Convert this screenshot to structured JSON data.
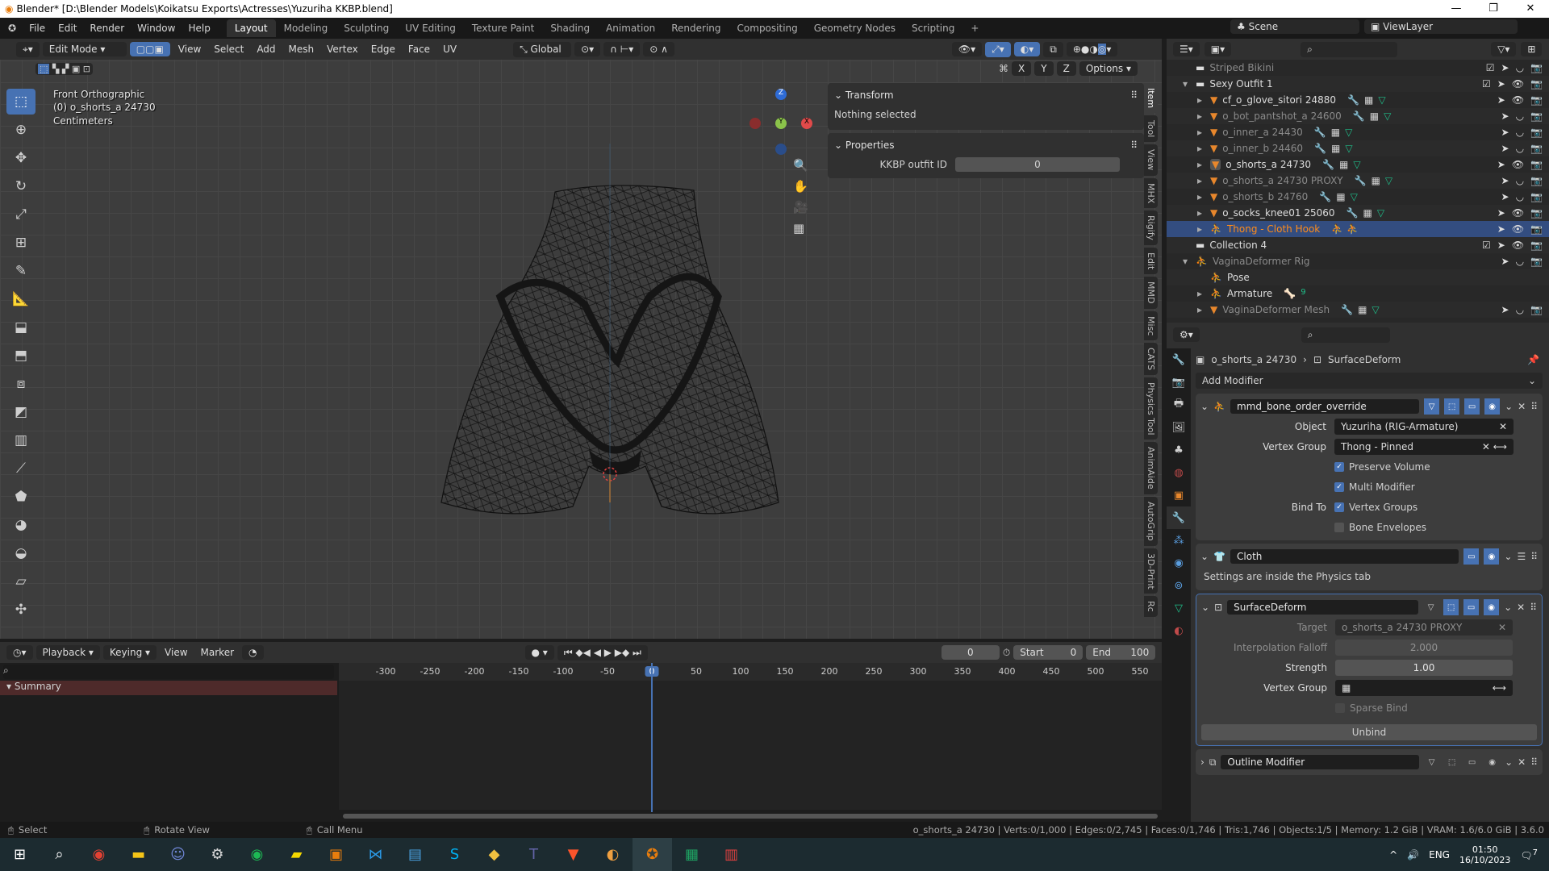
{
  "window": {
    "title": "Blender* [D:\\Blender Models\\Koikatsu Exports\\Actresses\\Yuzuriha KKBP.blend]"
  },
  "menu": [
    "File",
    "Edit",
    "Render",
    "Window",
    "Help"
  ],
  "workspaces": [
    "Layout",
    "Modeling",
    "Sculpting",
    "UV Editing",
    "Texture Paint",
    "Shading",
    "Animation",
    "Rendering",
    "Compositing",
    "Geometry Nodes",
    "Scripting",
    "+"
  ],
  "scene": {
    "name": "Scene",
    "view_layer": "ViewLayer"
  },
  "viewport": {
    "mode": "Edit Mode",
    "header_menus": [
      "View",
      "Select",
      "Add",
      "Mesh",
      "Vertex",
      "Edge",
      "Face",
      "UV"
    ],
    "orientation": "Global",
    "axes": [
      "X",
      "Y",
      "Z"
    ],
    "options": "Options",
    "overlay_lines": [
      "Front Orthographic",
      "(0) o_shorts_a 24730",
      "Centimeters"
    ],
    "gizmo": {
      "z": "Z",
      "y": "Y",
      "x": "X"
    },
    "npanel": {
      "transform_title": "Transform",
      "nothing_selected": "Nothing selected",
      "properties_title": "Properties",
      "kkbp_label": "KKBP outfit ID",
      "kkbp_value": "0"
    },
    "side_tabs": [
      "Item",
      "Tool",
      "View",
      "MHX",
      "Rigify",
      "Edit",
      "MMD",
      "Misc",
      "CATS",
      "Physics Tool",
      "AnimAide",
      "AutoGrip",
      "3D-Print",
      "Rc"
    ]
  },
  "outliner": {
    "rows": [
      {
        "name": "Striped Bikini",
        "type": "collection",
        "dim": true
      },
      {
        "name": "Sexy Outfit 1",
        "type": "collection"
      },
      {
        "name": "cf_o_glove_sitori 24880",
        "type": "mesh"
      },
      {
        "name": "o_bot_pantshot_a 24600",
        "type": "mesh",
        "dim": true
      },
      {
        "name": "o_inner_a 24430",
        "type": "mesh",
        "dim": true
      },
      {
        "name": "o_inner_b 24460",
        "type": "mesh",
        "dim": true
      },
      {
        "name": "o_shorts_a 24730",
        "type": "mesh",
        "active": true
      },
      {
        "name": "o_shorts_a 24730 PROXY",
        "type": "mesh",
        "dim": true
      },
      {
        "name": "o_shorts_b 24760",
        "type": "mesh",
        "dim": true
      },
      {
        "name": "o_socks_knee01 25060",
        "type": "mesh"
      },
      {
        "name": "Thong - Cloth Hook",
        "type": "armature",
        "selected": true
      },
      {
        "name": "Collection 4",
        "type": "collection"
      },
      {
        "name": "VaginaDeformer Rig",
        "type": "armature",
        "dim": true
      },
      {
        "name": "Pose",
        "type": "pose"
      },
      {
        "name": "Armature",
        "type": "armature-data",
        "badge": "9"
      },
      {
        "name": "VaginaDeformer Mesh",
        "type": "mesh",
        "dim": true
      }
    ]
  },
  "properties": {
    "breadcrumb_object": "o_shorts_a 24730",
    "breadcrumb_modifier": "SurfaceDeform",
    "add_modifier": "Add Modifier",
    "mod1": {
      "name": "mmd_bone_order_override",
      "object_label": "Object",
      "object_value": "Yuzuriha (RIG-Armature)",
      "vg_label": "Vertex Group",
      "vg_value": "Thong - Pinned",
      "preserve_volume": "Preserve Volume",
      "multi_modifier": "Multi Modifier",
      "bind_to": "Bind To",
      "vertex_groups": "Vertex Groups",
      "bone_envelopes": "Bone Envelopes"
    },
    "mod2": {
      "name": "Cloth",
      "note": "Settings are inside the Physics tab"
    },
    "mod3": {
      "name": "SurfaceDeform",
      "target_label": "Target",
      "target_value": "o_shorts_a 24730 PROXY",
      "falloff_label": "Interpolation Falloff",
      "falloff_value": "2.000",
      "strength_label": "Strength",
      "strength_value": "1.00",
      "vg_label": "Vertex Group",
      "sparse_bind": "Sparse Bind",
      "unbind": "Unbind"
    },
    "mod4": {
      "name": "Outline Modifier"
    }
  },
  "timeline": {
    "menus": [
      "Playback",
      "Keying",
      "View",
      "Marker"
    ],
    "current_frame": "0",
    "start_label": "Start",
    "start": "0",
    "end_label": "End",
    "end": "100",
    "ticks": [
      "-300",
      "-250",
      "-200",
      "-150",
      "-100",
      "-50",
      "0",
      "50",
      "100",
      "150",
      "200",
      "250",
      "300",
      "350",
      "400",
      "450",
      "500",
      "550"
    ],
    "summary": "Summary"
  },
  "status": {
    "select": "Select",
    "rotate": "Rotate View",
    "call_menu": "Call Menu",
    "stats": "o_shorts_a 24730 | Verts:0/1,000 | Edges:0/2,745 | Faces:0/1,746 | Tris:1,746 | Objects:1/5 | Memory: 1.2 GiB | VRAM: 1.6/6.0 GiB | 3.6.0"
  },
  "taskbar": {
    "lang": "ENG",
    "time": "01:50",
    "date": "16/10/2023",
    "notifications": "7"
  }
}
